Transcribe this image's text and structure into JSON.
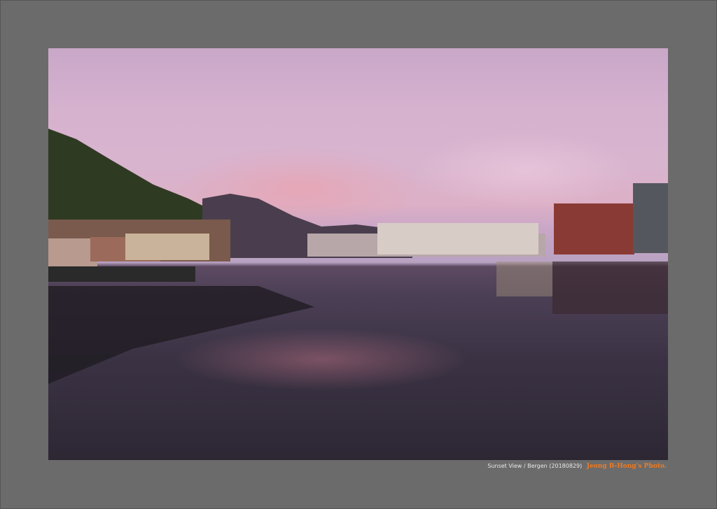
{
  "caption": {
    "title": "Sunset View / Bergen (20180829)",
    "credit": "Jeong B-Hong's Photo."
  },
  "colors": {
    "frame": "#6b6b6b",
    "credit": "#f07a20"
  }
}
